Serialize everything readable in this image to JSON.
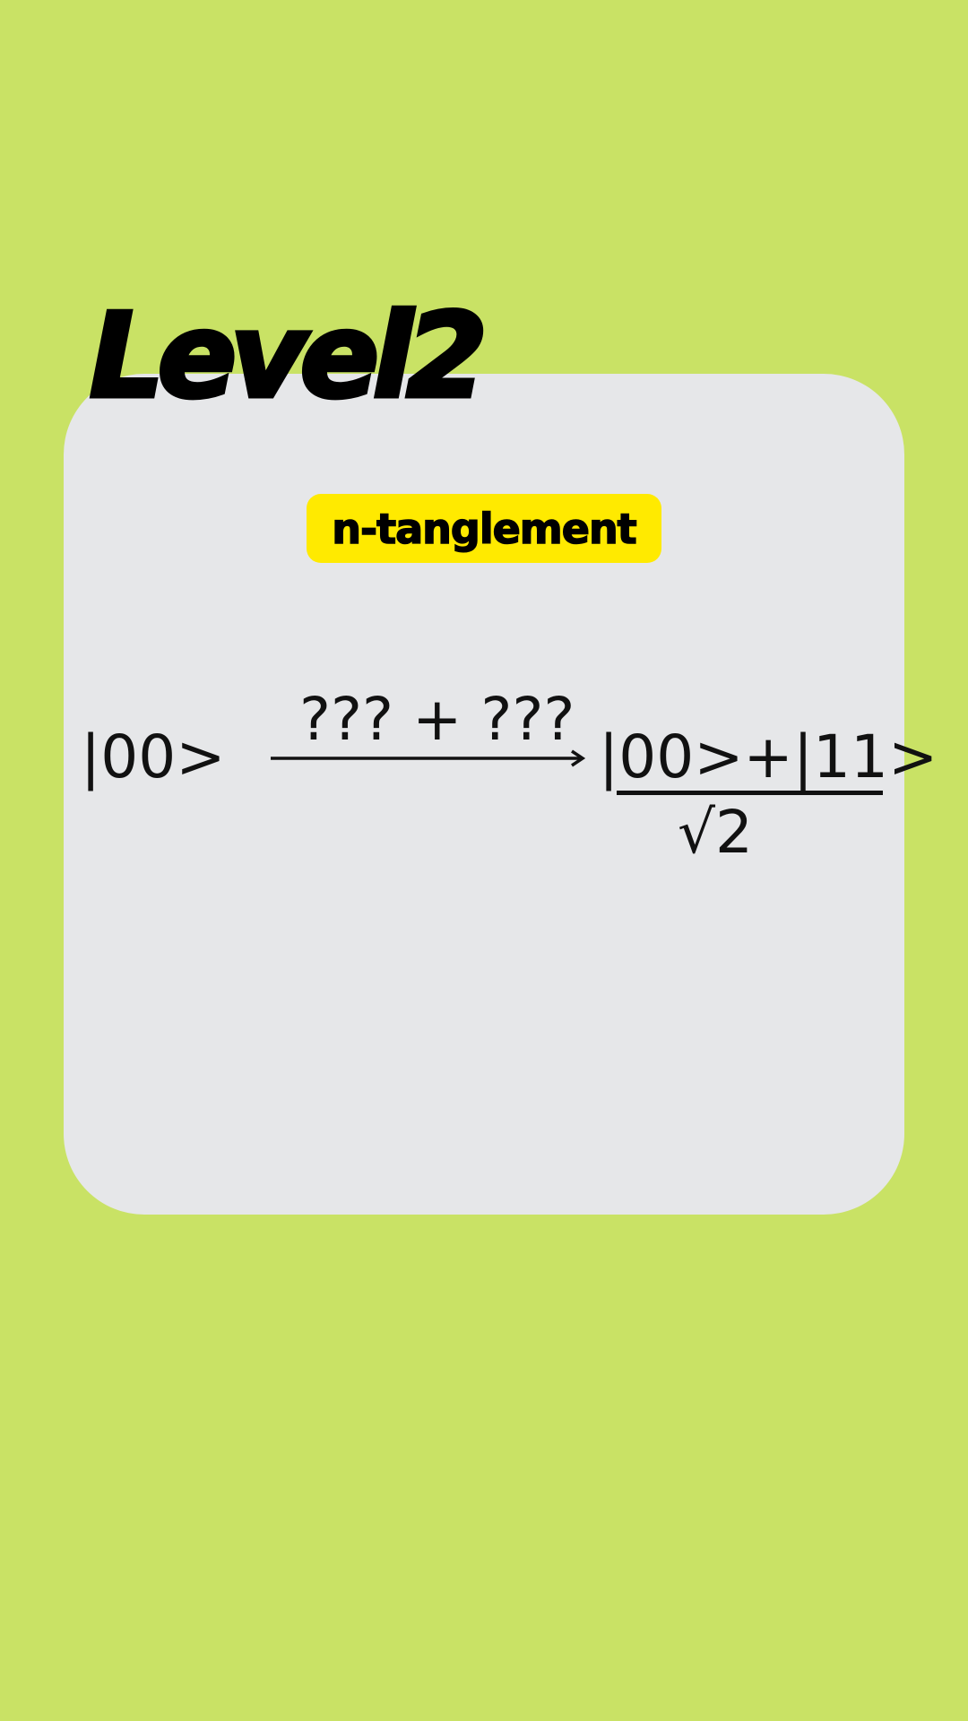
{
  "level": {
    "title": "Level2"
  },
  "puzzle": {
    "name": "n-tanglement",
    "initial_state": "|00>",
    "operation": "??? + ???",
    "result_numerator": "|00>+|11>",
    "result_denominator": "√2"
  },
  "colors": {
    "background": "#c9e265",
    "card": "#e6e7e9",
    "tag": "#ffea00",
    "text": "#000000"
  },
  "icons": {
    "arrow": "right-arrow-icon"
  }
}
